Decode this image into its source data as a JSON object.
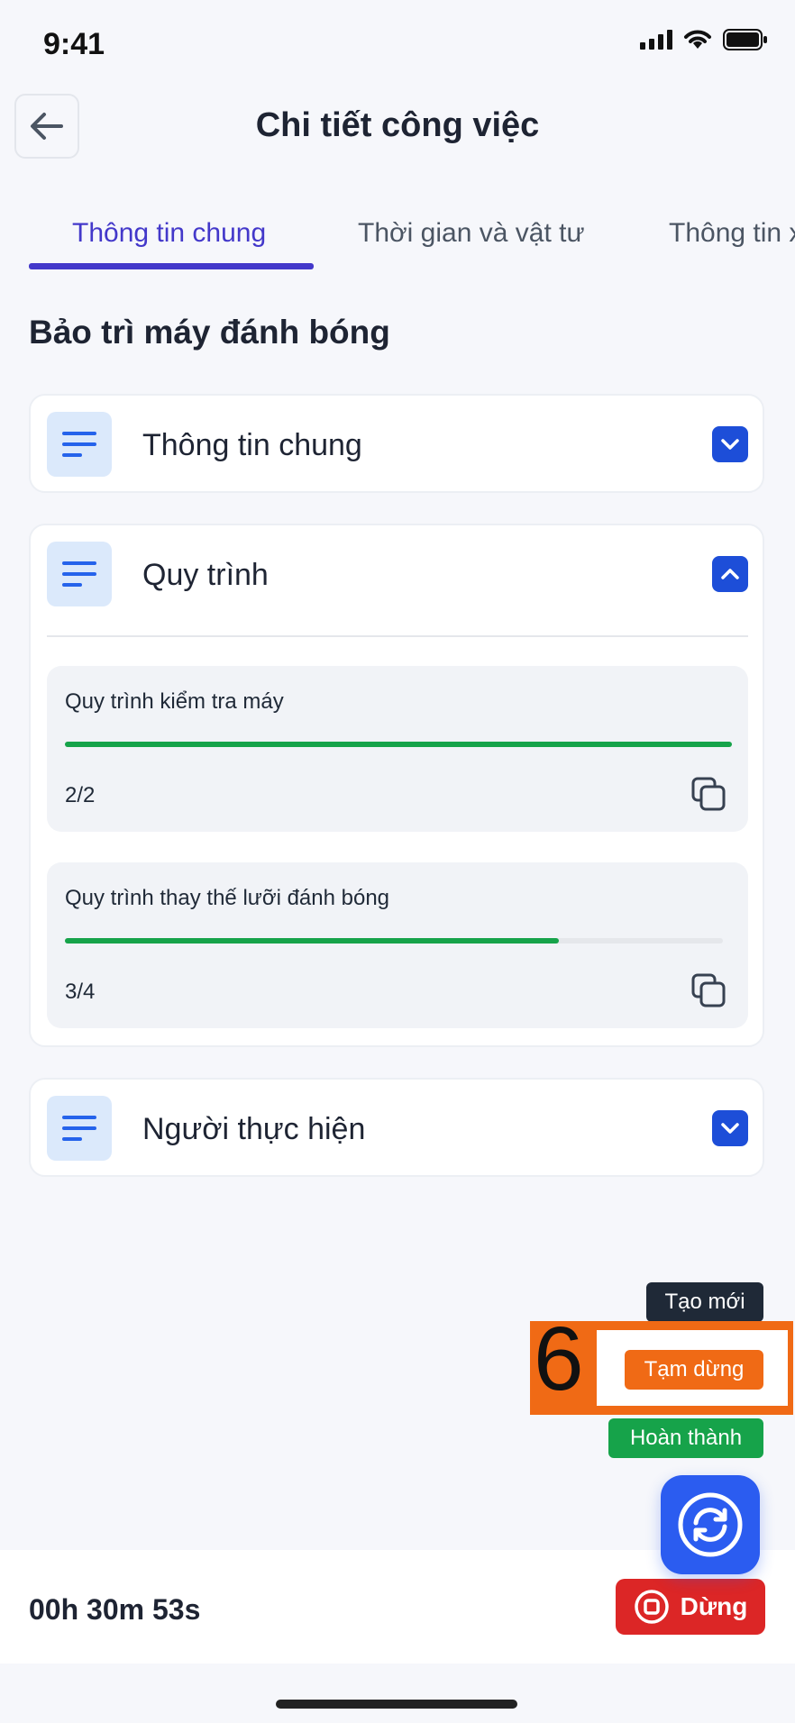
{
  "status_bar": {
    "time": "9:41"
  },
  "header": {
    "title": "Chi tiết công việc"
  },
  "tabs": [
    {
      "label": "Thông tin chung",
      "active": true
    },
    {
      "label": "Thời gian và vật tư",
      "active": false
    },
    {
      "label": "Thông tin x",
      "active": false
    }
  ],
  "section_title": "Bảo trì máy đánh bóng",
  "cards": {
    "general": {
      "label": "Thông tin chung",
      "expanded": false
    },
    "process": {
      "label": "Quy trình",
      "expanded": true,
      "items": [
        {
          "title": "Quy trình kiểm tra máy",
          "count": "2/2",
          "progress": 1.0
        },
        {
          "title": "Quy trình thay thế lưỡi đánh bóng",
          "count": "3/4",
          "progress": 0.75
        }
      ]
    },
    "performer": {
      "label": "Người thực hiện",
      "expanded": false
    }
  },
  "actions": {
    "create": "Tạo mới",
    "pause": "Tạm dừng",
    "complete": "Hoàn thành",
    "highlight_number": "6"
  },
  "bottom": {
    "timer": "00h 30m 53s",
    "stop_label": "Dừng"
  },
  "colors": {
    "accent": "#4338ca",
    "primary_blue": "#1d4ed8",
    "progress_green": "#16a34a",
    "create_bg": "#1f2937",
    "pause_bg": "#f06a15",
    "complete_bg": "#16a34a",
    "stop_bg": "#dc2626"
  }
}
